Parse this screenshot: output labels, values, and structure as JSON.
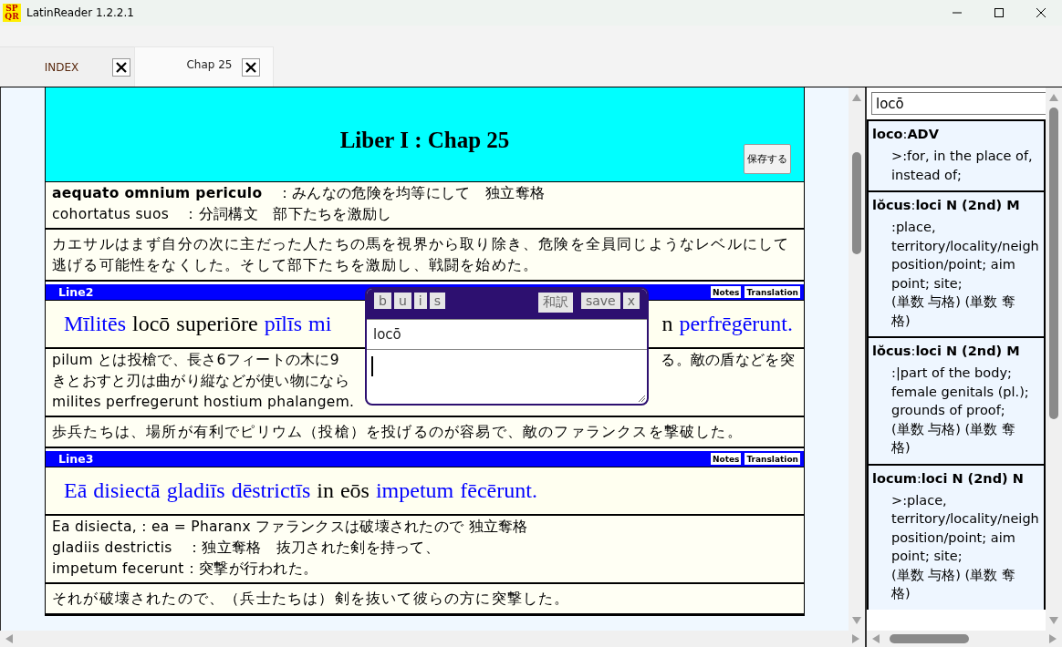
{
  "window": {
    "title": "LatinReader 1.2.2.1",
    "icon_letters": [
      "SP",
      "QR"
    ]
  },
  "tabs": [
    {
      "label": "INDEX",
      "selected": false
    },
    {
      "label": "Chap 25",
      "selected": true
    }
  ],
  "chapter": {
    "title": "Liber I : Chap 25",
    "save_button": "保存する"
  },
  "blocks": [
    {
      "kind": "note",
      "lines": [
        {
          "text": "**aequato omnium periculo**　：みんなの危険を均等にして　独立奪格"
        },
        {
          "text": "cohortatus suos　：分詞構文　部下たちを激励し"
        }
      ]
    },
    {
      "kind": "translation",
      "lines": [
        "カエサルはまず自分の次に主だった人たちの馬を視界から取り除き、危険を全員同じようなレベルにして",
        "逃げる可能性をなくした。そして部下たちを激励し、戦闘を始めた。"
      ]
    },
    {
      "kind": "header",
      "label": "Line2",
      "buttons": [
        "Notes",
        "Translation"
      ]
    },
    {
      "kind": "latin",
      "words": [
        {
          "text": "Mīlitēs",
          "highlighted": true
        },
        {
          "text": "locō",
          "highlighted": false
        },
        {
          "text": "superiōre",
          "highlighted": false
        },
        {
          "text": "pīlīs",
          "highlighted": true
        },
        {
          "text": "mi",
          "highlighted": true
        }
      ],
      "words_after_popup": [
        {
          "text": "n",
          "highlighted": false
        },
        {
          "text": "perfrēgērunt.",
          "highlighted": true
        }
      ]
    },
    {
      "kind": "note",
      "lines": [
        {
          "text": "pilum とは投槍で、長さ6フィートの木に9",
          "text_after_popup": "る。敵の盾などを突"
        },
        {
          "text": "きとおすと刃は曲がり縦などが使い物になら"
        },
        {
          "text": "milites perfregerunt hostium phalangem."
        }
      ]
    },
    {
      "kind": "translation",
      "lines": [
        "歩兵たちは、場所が有利でピリウム（投槍）を投げるのが容易で、敵のファランクスを撃破した。"
      ]
    },
    {
      "kind": "header",
      "label": "Line3",
      "buttons": [
        "Notes",
        "Translation"
      ]
    },
    {
      "kind": "latin",
      "words": [
        {
          "text": "Eā",
          "highlighted": true
        },
        {
          "text": "disiectā",
          "highlighted": true
        },
        {
          "text": "gladiīs",
          "highlighted": true
        },
        {
          "text": "dēstrictīs",
          "highlighted": true
        },
        {
          "text": "in",
          "highlighted": false
        },
        {
          "text": "eōs",
          "highlighted": false
        },
        {
          "text": "impetum",
          "highlighted": true
        },
        {
          "text": "fēcērunt.",
          "highlighted": true
        }
      ]
    },
    {
      "kind": "note",
      "lines": [
        {
          "text": "Ea disiecta, : ea = Pharanx ファランクスは破壊されたので 独立奪格"
        },
        {
          "text": "gladiis destrictis　：独立奪格　抜刀された剣を持って、"
        },
        {
          "text": "impetum fecerunt：突撃が行われた。"
        }
      ]
    },
    {
      "kind": "translation",
      "lines": [
        "それが破壊されたので、（兵士たちは）剣を抜いて彼らの方に突撃した。"
      ]
    }
  ],
  "popup": {
    "format_buttons": [
      "b",
      "u",
      "i",
      "s"
    ],
    "action_buttons": [
      "和訳",
      "save",
      "x"
    ],
    "word": "locō"
  },
  "dictionary": {
    "search": "locō",
    "entries": [
      {
        "title": "**loco**:**ADV**",
        "lines": [
          ">:for, in the place of,",
          "instead of;"
        ]
      },
      {
        "title": "**lŏcus**:**loci N (2nd) M**",
        "lines": [
          ":place,",
          "territory/locality/neigh",
          "position/point; aim",
          "point; site;",
          "(単数 与格) (単数 奪",
          "格)"
        ]
      },
      {
        "title": "**lŏcus**:**loci N (2nd) M**",
        "lines": [
          ":|part of the body;",
          "female genitals (pl.);",
          "grounds of proof;",
          "(単数 与格) (単数 奪",
          "格)"
        ]
      },
      {
        "title": "**locum**:**loci N (2nd) N**",
        "lines": [
          ">:place,",
          "territory/locality/neigh",
          "position/point; aim",
          "point; site;",
          "(単数 与格) (単数 奪",
          "格)"
        ]
      }
    ]
  }
}
